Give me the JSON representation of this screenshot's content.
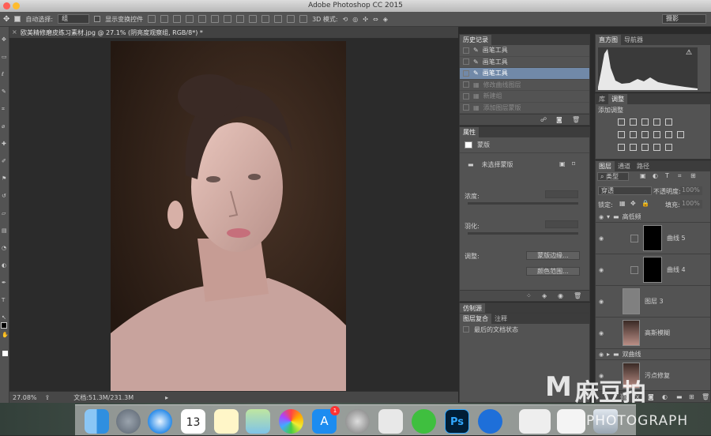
{
  "window": {
    "title": "Adobe Photoshop CC 2015"
  },
  "options_bar": {
    "auto_select_label": "自动选择:",
    "auto_select_value": "组",
    "show_transform_label": "显示变换控件",
    "mode3d_label": "3D 模式:",
    "workspace": "摄影"
  },
  "document": {
    "tab_title": "欧美精修磨皮练习素材.jpg @ 27.1% (阴亮度观察组, RGB/8*) *",
    "zoom": "27.08%",
    "doc_size": "文档:51.3M/231.3M"
  },
  "history": {
    "tab": "历史记录",
    "items": [
      {
        "label": "画笔工具",
        "state": "normal"
      },
      {
        "label": "画笔工具",
        "state": "normal"
      },
      {
        "label": "画笔工具",
        "state": "selected"
      },
      {
        "label": "修改曲线图层",
        "state": "dim"
      },
      {
        "label": "新建组",
        "state": "dim"
      },
      {
        "label": "添加图层蒙版",
        "state": "dim"
      }
    ]
  },
  "properties": {
    "tab": "属性",
    "mask_label": "蒙版",
    "no_mask": "未选择蒙版",
    "density": "浓度:",
    "feather": "羽化:",
    "adjust": "调整:",
    "mask_edge_btn": "蒙版边缘...",
    "color_range_btn": "颜色范围..."
  },
  "lower_panel": {
    "clone_tab": "仿制源",
    "comp_tab": "图层复合",
    "notes_tab": "注释",
    "last_state": "最后的文档状态"
  },
  "histogram": {
    "tab1": "直方图",
    "tab2": "导航器"
  },
  "adjustments": {
    "tab1": "库",
    "tab2": "调整",
    "add_label": "添加调整"
  },
  "layers": {
    "tab1": "图层",
    "tab2": "通道",
    "tab3": "路径",
    "filter": "类型",
    "blend": "穿透",
    "opacity_label": "不透明度:",
    "opacity": "100%",
    "lock_label": "锁定:",
    "fill_label": "填充:",
    "fill": "100%",
    "rows": [
      {
        "name": "高低频",
        "kind": "group-open"
      },
      {
        "name": "曲线 5",
        "kind": "adjust"
      },
      {
        "name": "曲线 4",
        "kind": "adjust"
      },
      {
        "name": "图层 3",
        "kind": "gray"
      },
      {
        "name": "高斯模糊",
        "kind": "photo"
      },
      {
        "name": "双曲线",
        "kind": "group-closed"
      },
      {
        "name": "污点修复",
        "kind": "photo"
      }
    ]
  },
  "watermark": {
    "brand": "麻豆拍",
    "sub": "PHOTOGRAPH"
  },
  "dock": {
    "calendar_day": "13",
    "appstore_badge": "1",
    "ps_label": "Ps"
  }
}
